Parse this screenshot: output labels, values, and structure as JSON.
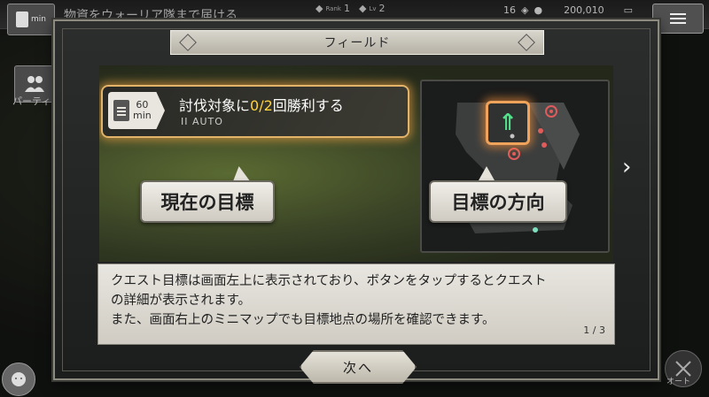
{
  "hud": {
    "quest_text": "物資をウォーリア隊まで届ける",
    "quest_time_label": "min",
    "rank_label": "Rank",
    "rank_value": "1",
    "level_label": "Lv",
    "level_value": "2",
    "badge_count": "16",
    "gold": "200,010"
  },
  "side": {
    "party_label": "パーティ",
    "auto_label": "オート"
  },
  "dialog": {
    "title": "フィールド",
    "quest_time_value": "60",
    "quest_time_unit": "min",
    "quest_text_prefix": "討伐対象に",
    "quest_text_progress": "0/2",
    "quest_text_suffix": "回勝利する",
    "quest_auto": "II AUTO",
    "callout_current_goal": "現在の目標",
    "callout_goal_direction": "目標の方向",
    "description_line1": "クエスト目標は画面左上に表示されており、ボタンをタップするとクエスト",
    "description_line2": "の詳細が表示されます。",
    "description_line3": "また、画面右上のミニマップでも目標地点の場所を確認できます。",
    "page_indicator": "1 / 3",
    "next_button": "次へ"
  },
  "colors": {
    "highlight_glow": "#f0a35a",
    "progress_text": "#ffd23c",
    "minimap_arrow": "#52e08a",
    "enemy_marker": "#e05b5b"
  }
}
